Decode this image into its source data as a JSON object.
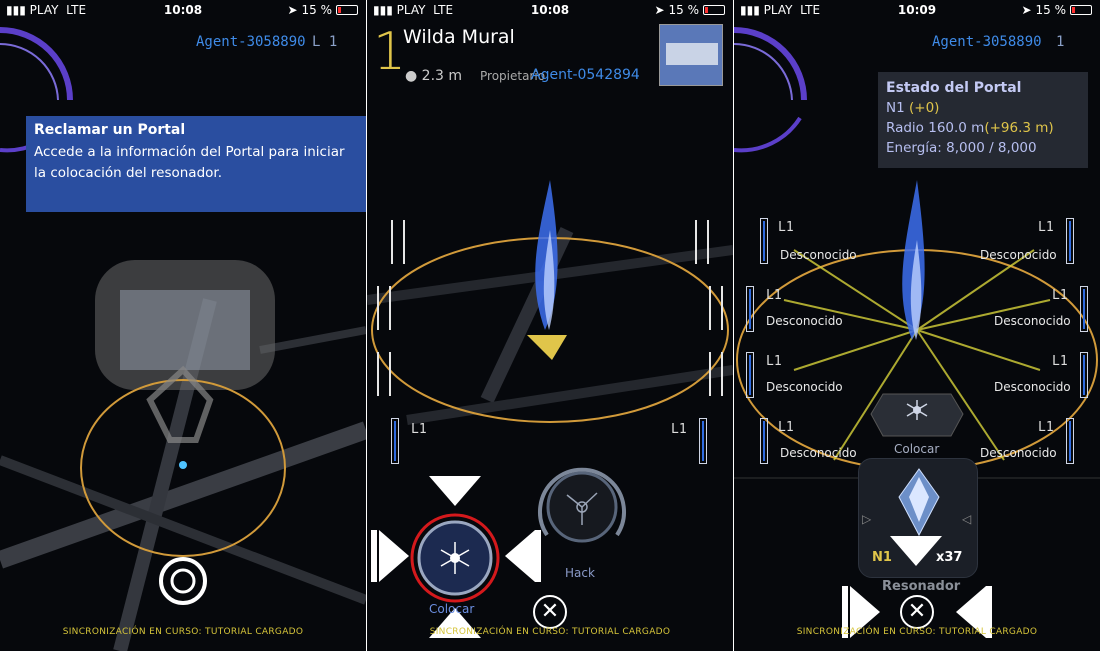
{
  "panels": [
    {
      "status": {
        "carrier": "▮▮▮ PLAY",
        "network": "LTE",
        "time": "10:08",
        "battery": "15 %"
      },
      "agent": "Agent-3058890",
      "level": "L 1",
      "tooltip": {
        "title": "Reclamar un Portal",
        "body": "Accede a la información del Portal para iniciar la colocación del resonador."
      },
      "sync": "SINCRONIZACIÓN EN CURSO: TUTORIAL CARGADO"
    },
    {
      "status": {
        "carrier": "▮▮▮ PLAY",
        "network": "LTE",
        "time": "10:08",
        "battery": "15 %"
      },
      "portal_level": "1",
      "portal_name": "Wilda Mural",
      "distance": "2.3 m",
      "owner_label": "Propietario",
      "owner": "Agent-0542894",
      "slot_left": "L1",
      "slot_right": "L1",
      "deploy_label": "Colocar",
      "hack_label": "Hack",
      "close": "✕",
      "sync": "SINCRONIZACIÓN EN CURSO: TUTORIAL CARGADO"
    },
    {
      "status": {
        "carrier": "▮▮▮ PLAY",
        "network": "LTE",
        "time": "10:09",
        "battery": "15 %"
      },
      "agent": "Agent-3058890",
      "level": "1",
      "portal_state": {
        "title": "Estado del Portal",
        "level": "N1",
        "level_delta": "(+0)",
        "radius_label": "Radio",
        "radius": "160.0 m",
        "radius_delta": "(+96.3 m)",
        "energy_label": "Energía:",
        "energy": "8,000 / 8,000"
      },
      "slots": [
        {
          "level": "L1",
          "label": "Desconocido"
        },
        {
          "level": "L1",
          "label": "Desconocido"
        },
        {
          "level": "L1",
          "label": "Desconocido"
        },
        {
          "level": "L1",
          "label": "Desconocido"
        },
        {
          "level": "L1",
          "label": "Desconocido"
        },
        {
          "level": "L1",
          "label": "Desconocido"
        },
        {
          "level": "L1",
          "label": "Desconocido"
        },
        {
          "level": "L1",
          "label": "Desconocido"
        }
      ],
      "deploy_label": "Colocar",
      "item_level": "N1",
      "item_count": "x37",
      "item_name": "Resonador",
      "close": "✕",
      "sync": "SINCRONIZACIÓN EN CURSO: TUTORIAL CARGADO"
    }
  ]
}
